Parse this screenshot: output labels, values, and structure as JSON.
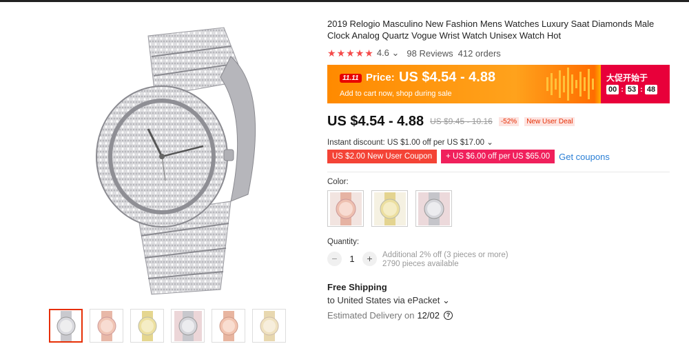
{
  "product": {
    "title": "2019 Relogio Masculino New Fashion Mens Watches Luxury Saat Diamonds Male Clock Analog Quartz Vogue Wrist Watch Unisex Watch Hot",
    "rating": "4.6",
    "rating_stars": 5,
    "reviews": "98 Reviews",
    "orders": "412 orders",
    "chevron": "⌄"
  },
  "promo": {
    "badge": "11.11",
    "price_label": "Price:",
    "price": "US $4.54 - 4.88",
    "subtitle": "Add to cart now, shop during sale",
    "countdown_title": "大促开始于",
    "countdown": [
      "00",
      "53",
      "48"
    ],
    "color_main": "#ff8a00",
    "color_right": "#e8003a"
  },
  "pricing": {
    "price": "US $4.54 - 4.88",
    "original": "US $9.45 - 10.16",
    "discount": "-52%",
    "deal": "New User Deal"
  },
  "discounts": {
    "instant": "Instant discount: US $1.00 off per US $17.00",
    "coupon_1": "US $2.00 New User Coupon",
    "coupon_2": "+ US $6.00 off per US $65.00",
    "get_coupons": "Get coupons"
  },
  "options": {
    "color_label": "Color:",
    "quantity_label": "Quantity:",
    "quantity": "1",
    "minus": "−",
    "plus": "+",
    "additional": "Additional 2% off (3 pieces or more)",
    "available": "2790 pieces available"
  },
  "shipping": {
    "title": "Free Shipping",
    "destination": "to United States via ePacket",
    "eta_label": "Estimated Delivery on",
    "eta_date": "12/02",
    "help": "?"
  },
  "icons": {
    "star": "star-icon",
    "chevron": "chevron-down-icon",
    "help": "help-icon"
  }
}
